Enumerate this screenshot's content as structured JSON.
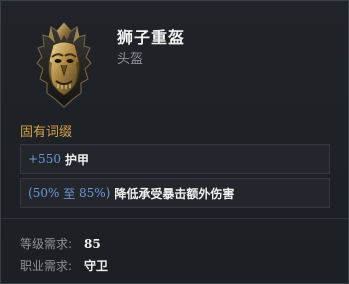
{
  "item": {
    "name": "狮子重盔",
    "type": "头盔"
  },
  "affixes": {
    "title": "固有词缀",
    "stat1": {
      "value": "+550",
      "label": "护甲"
    },
    "stat2": {
      "open_paren": "(",
      "min": "50%",
      "sep": "至",
      "max": "85%",
      "close_paren": ")",
      "label": "降低承受暴击额外伤害"
    }
  },
  "requirements": {
    "level_label": "等级需求:",
    "level_value": "85",
    "class_label": "职业需求:",
    "class_value": "守卫"
  },
  "colors": {
    "background": "#1c1f23",
    "section_title": "#d5a24a",
    "numeric_value": "#6f95d6",
    "label_gray": "#8d9196",
    "text_white": "#f0f0f0"
  },
  "icons": {
    "item_icon": "lion-helmet-icon"
  }
}
